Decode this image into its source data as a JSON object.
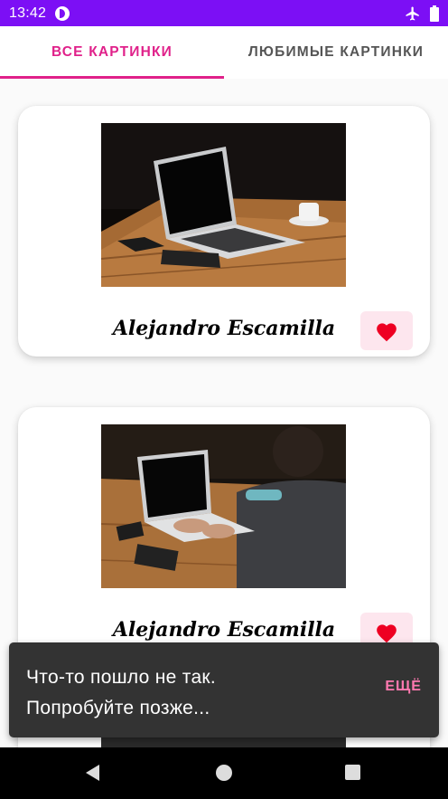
{
  "status_bar": {
    "time": "13:42",
    "icons": [
      "app-notification-icon",
      "airplane-mode-icon",
      "battery-icon"
    ],
    "color": "#7c0ff5"
  },
  "tabs": [
    {
      "label": "ВСЕ КАРТИНКИ",
      "active": true
    },
    {
      "label": "ЛЮБИМЫЕ КАРТИНКИ",
      "active": false
    }
  ],
  "accent_color": "#e0218a",
  "cards": [
    {
      "author": "Alejandro Escamilla",
      "favorite_icon": "heart-icon"
    },
    {
      "author": "Alejandro Escamilla",
      "favorite_icon": "heart-icon"
    }
  ],
  "snackbar": {
    "message_line1": "Что-то пошло не так.",
    "message_line2": "Попробуйте позже...",
    "action": "ЕЩЁ"
  },
  "nav_bar": {
    "icons": [
      "back-icon",
      "home-icon",
      "recents-icon"
    ]
  }
}
